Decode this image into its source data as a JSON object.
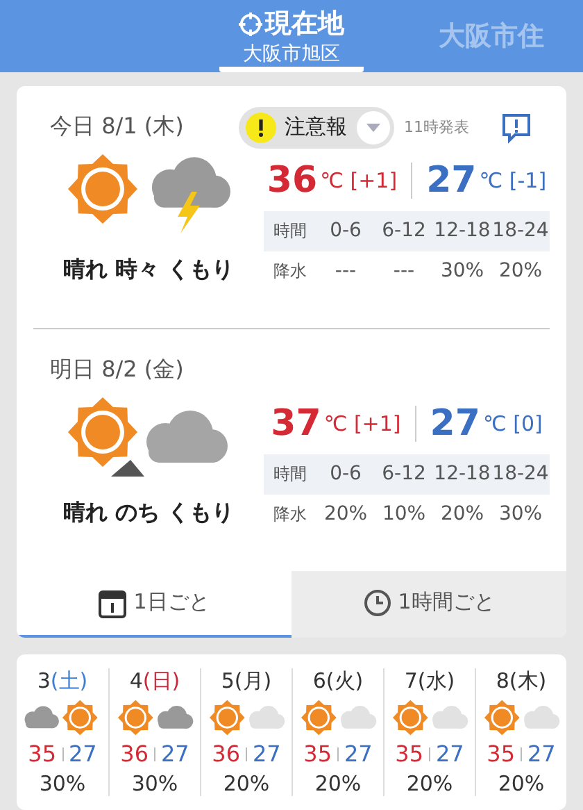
{
  "locations": [
    {
      "kind": "current",
      "label": "現在地",
      "sublabel": "大阪市旭区",
      "selected": true
    },
    {
      "kind": "city",
      "label": "大阪市住",
      "selected": false
    }
  ],
  "days": [
    {
      "label": "今日",
      "date": "8/1 (木)",
      "icon": {
        "kind": "sun_storm"
      },
      "description": "晴れ 時々 くもり",
      "high": "36",
      "high_unit": "℃",
      "high_diff": "[+1]",
      "low": "27",
      "low_unit": "℃",
      "low_diff": "[-1]",
      "time_label": "時間",
      "slots": [
        "0-6",
        "6-12",
        "12-18",
        "18-24"
      ],
      "rain_label": "降水",
      "rain": [
        "---",
        "---",
        "30%",
        "20%"
      ],
      "warning": {
        "label": "注意報",
        "issued": "11時発表"
      }
    },
    {
      "label": "明日",
      "date": "8/2 (金)",
      "icon": {
        "kind": "sun_then_cloud"
      },
      "description": "晴れ のち くもり",
      "high": "37",
      "high_unit": "℃",
      "high_diff": "[+1]",
      "low": "27",
      "low_unit": "℃",
      "low_diff": "[0]",
      "time_label": "時間",
      "slots": [
        "0-6",
        "6-12",
        "12-18",
        "18-24"
      ],
      "rain_label": "降水",
      "rain": [
        "20%",
        "10%",
        "20%",
        "30%"
      ]
    }
  ],
  "view_tabs": [
    {
      "kind": "day",
      "label": "1日ごと",
      "selected": true
    },
    {
      "kind": "hour",
      "label": "1時間ごと",
      "selected": false
    }
  ],
  "week": [
    {
      "day": "3",
      "weekday": "(土)",
      "color": "#3f7fd0",
      "icon": {
        "kind": "cloud_sun"
      },
      "high": "35",
      "low": "27",
      "rain": "30%"
    },
    {
      "day": "4",
      "weekday": "(日)",
      "color": "#c8283a",
      "icon": {
        "kind": "sun_darkcloud"
      },
      "high": "36",
      "low": "27",
      "rain": "30%"
    },
    {
      "day": "5",
      "weekday": "(月)",
      "color": "#333333",
      "icon": {
        "kind": "sun_cloud"
      },
      "high": "36",
      "low": "27",
      "rain": "20%"
    },
    {
      "day": "6",
      "weekday": "(火)",
      "color": "#333333",
      "icon": {
        "kind": "sun_cloud"
      },
      "high": "35",
      "low": "27",
      "rain": "20%"
    },
    {
      "day": "7",
      "weekday": "(水)",
      "color": "#333333",
      "icon": {
        "kind": "sun_cloud"
      },
      "high": "35",
      "low": "27",
      "rain": "20%"
    },
    {
      "day": "8",
      "weekday": "(木)",
      "color": "#333333",
      "icon": {
        "kind": "sun_cloud"
      },
      "high": "35",
      "low": "27",
      "rain": "20%"
    }
  ]
}
